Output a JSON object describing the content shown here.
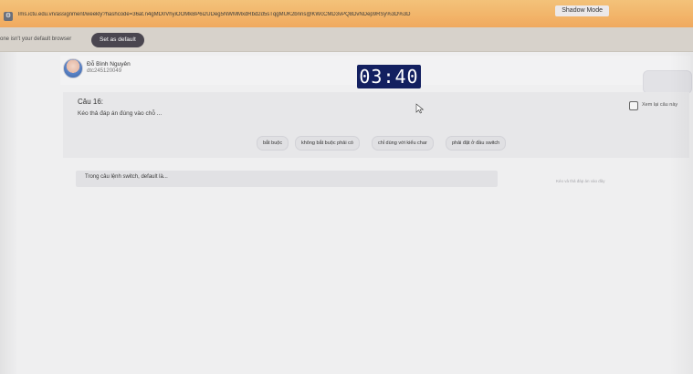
{
  "browser": {
    "shadow_mode_label": "Shadow Mode",
    "url": "lms.ictu.edu.vn/assignment/weekly?hashcode=36at.n4gMD0VhyiOOMkBP6i2UDeg5NWMMxdRbd2d5sTqgMUK2bnns@KWcCMD3vPQ8DvNDep9RSy%3D%3D",
    "default_banner": {
      "text": "one isn't your default browser",
      "button_label": "Set as default"
    }
  },
  "user": {
    "name": "Đỗ Bình Nguyên",
    "student_id": "dtc245120049"
  },
  "timer": {
    "display": "03:40"
  },
  "question": {
    "title": "Câu 16:",
    "prompt": "Kéo thả đáp án đúng vào chỗ ...",
    "review_label": "Xem lại câu này",
    "chips": [
      "bắt buộc",
      "không bắt buộc phải có",
      "chỉ dùng với kiểu char",
      "phải đặt ở đầu switch"
    ],
    "statement": "Trong câu lệnh switch, default là...",
    "drop_hint": "Kéo và thả đáp án vào đây"
  }
}
